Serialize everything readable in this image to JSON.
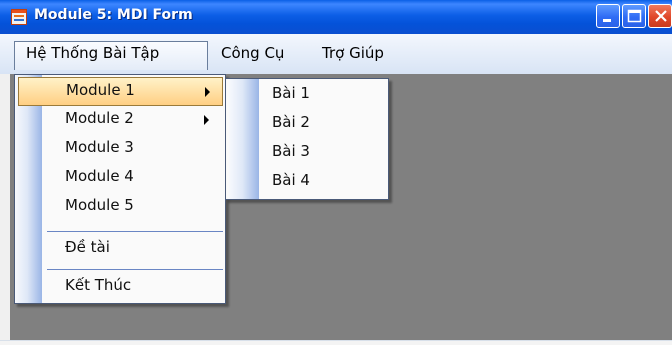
{
  "window": {
    "title": "Module 5: MDI Form",
    "app_icon": "form-icon",
    "controls": {
      "minimize": "minimize-icon",
      "maximize": "maximize-icon",
      "close": "close-icon"
    }
  },
  "menubar": {
    "items": [
      {
        "label": "Hệ Thống Bài Tập",
        "state": "open"
      },
      {
        "label": "Công Cụ"
      },
      {
        "label": "Trợ Giúp"
      }
    ]
  },
  "dropdown": {
    "items": [
      {
        "label": "Module 1",
        "submenu": true,
        "highlighted": true
      },
      {
        "label": "Module 2",
        "submenu": true
      },
      {
        "label": "Module 3"
      },
      {
        "label": "Module 4"
      },
      {
        "label": "Module 5"
      },
      {
        "label": "Đề tài"
      },
      {
        "label": "Kết Thúc"
      }
    ]
  },
  "submenu": {
    "parent": "Module 1",
    "items": [
      {
        "label": "Bài 1"
      },
      {
        "label": "Bài 2"
      },
      {
        "label": "Bài 3"
      },
      {
        "label": "Bài 4"
      }
    ]
  },
  "colors": {
    "titlebar": "#0a5fe6",
    "mdi_background": "#808080",
    "highlight": "#ffcf83",
    "menubar": "#dce7f7"
  }
}
